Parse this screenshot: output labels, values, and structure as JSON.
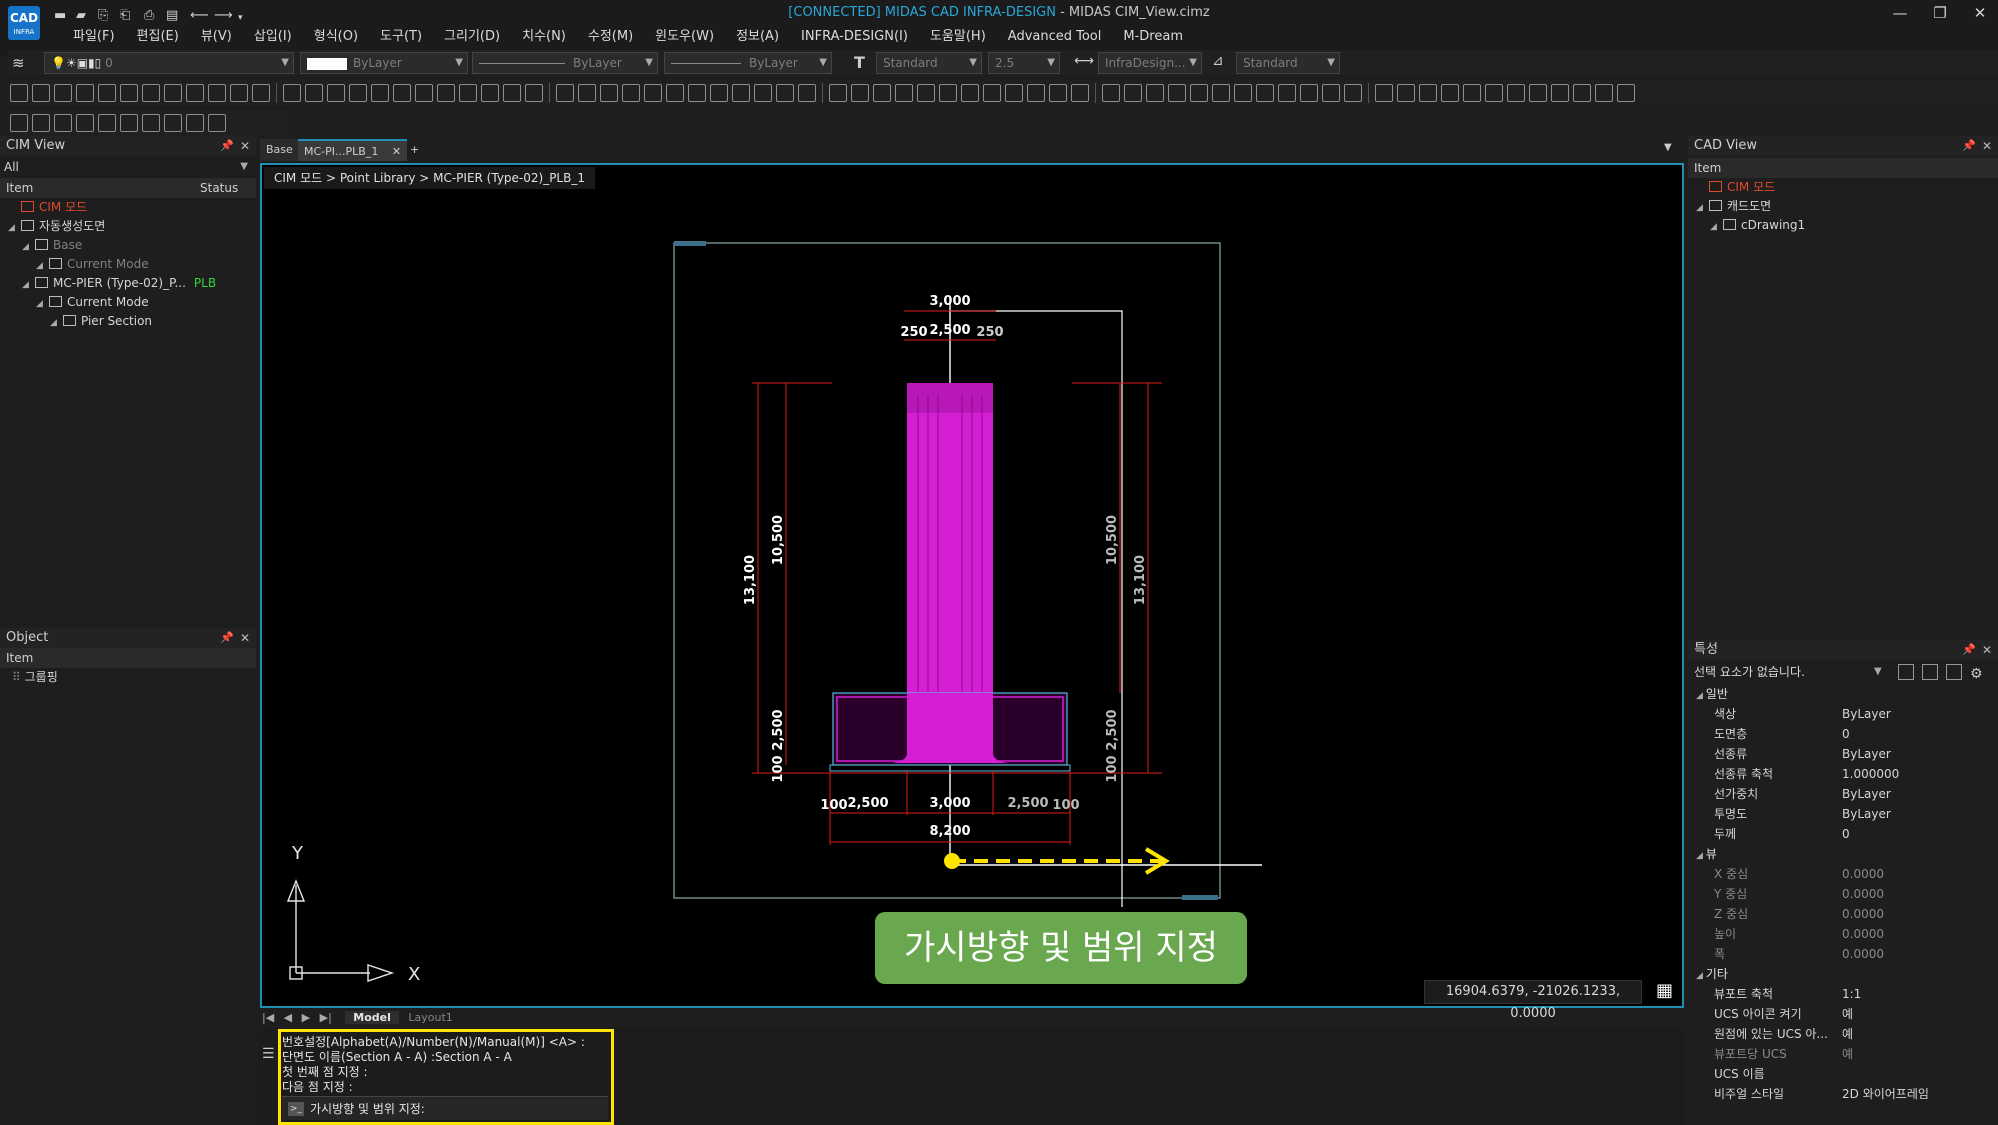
{
  "app": {
    "title_connected": "[CONNECTED] MIDAS CAD INFRA-DESIGN",
    "title_file": " - MIDAS CIM_View.cimz",
    "logo_text": "CAD"
  },
  "menu": [
    "파일(F)",
    "편집(E)",
    "뷰(V)",
    "삽입(I)",
    "형식(O)",
    "도구(T)",
    "그리기(D)",
    "치수(N)",
    "수정(M)",
    "윈도우(W)",
    "정보(A)",
    "INFRA-DESIGN(I)",
    "도움말(H)",
    "Advanced Tool",
    "M-Dream"
  ],
  "toolbar": {
    "layer_value": "0",
    "color_value": "ByLayer",
    "linetype_value": "ByLayer",
    "lineweight_value": "ByLayer",
    "textstyle_value": "Standard",
    "textheight_value": "2.5",
    "dimstyle_value": "InfraDesign...",
    "tablestyle_value": "Standard"
  },
  "cim_view": {
    "title": "CIM View",
    "filter": "All",
    "col_item": "Item",
    "col_status": "Status",
    "tree": [
      {
        "label": "CIM 모드",
        "level": 0,
        "style": "red"
      },
      {
        "label": "자동생성도면",
        "level": 0,
        "style": "normal"
      },
      {
        "label": "Base",
        "level": 1,
        "style": "dim"
      },
      {
        "label": "Current Mode",
        "level": 2,
        "style": "dim"
      },
      {
        "label": "MC-PIER (Type-02)_P...",
        "level": 1,
        "style": "normal",
        "status": "PLB"
      },
      {
        "label": "Current Mode",
        "level": 2,
        "style": "normal"
      },
      {
        "label": "Pier Section",
        "level": 3,
        "style": "normal"
      }
    ]
  },
  "object_panel": {
    "title": "Object",
    "col_item": "Item",
    "items": [
      "그룹핑"
    ]
  },
  "doc_tabs": [
    "Base",
    "MC-PI...PLB_1"
  ],
  "breadcrumb": "CIM 모드 > Point Library > MC-PIER (Type-02)_PLB_1",
  "drawing": {
    "dims_top": [
      "3,000",
      "250",
      "2,500",
      "250"
    ],
    "dims_left": [
      "13,100",
      "10,500",
      "2,500",
      "100"
    ],
    "dims_right": [
      "10,500",
      "13,100",
      "2,500",
      "100"
    ],
    "dims_bottom": [
      "100",
      "2,500",
      "3,000",
      "2,500",
      "100"
    ],
    "dim_total": "8,200",
    "axis_x": "X",
    "axis_y": "Y"
  },
  "callout": "가시방향 및 범위 지정",
  "coords": "16904.6379, -21026.1233, 0.0000",
  "layout_tabs": [
    "Model",
    "Layout1"
  ],
  "command": {
    "lines": [
      "번호설정[Alphabet(A)/Number(N)/Manual(M)] <A> :",
      "단면도 이름(Section A - A) :Section A - A",
      "첫 번째 점 지정 :",
      "다음 점 지정 :"
    ],
    "prompt": "가시방향 및 범위 지정:"
  },
  "cad_view": {
    "title": "CAD View",
    "col_item": "Item",
    "tree": [
      {
        "label": "CIM 모드",
        "level": 0,
        "style": "red"
      },
      {
        "label": "캐드도면",
        "level": 0,
        "style": "normal"
      },
      {
        "label": "cDrawing1",
        "level": 1,
        "style": "normal"
      }
    ]
  },
  "properties": {
    "title": "특성",
    "selection": "선택 요소가 없습니다.",
    "categories": [
      {
        "name": "일반",
        "rows": [
          {
            "k": "색상",
            "v": "ByLayer"
          },
          {
            "k": "도면층",
            "v": "0"
          },
          {
            "k": "선종류",
            "v": "ByLayer"
          },
          {
            "k": "선종류 축척",
            "v": "1.000000"
          },
          {
            "k": "선가중치",
            "v": "ByLayer"
          },
          {
            "k": "투명도",
            "v": "ByLayer"
          },
          {
            "k": "두께",
            "v": "0"
          }
        ]
      },
      {
        "name": "뷰",
        "rows": [
          {
            "k": "X 중심",
            "v": "0.0000",
            "dim": true
          },
          {
            "k": "Y 중심",
            "v": "0.0000",
            "dim": true
          },
          {
            "k": "Z 중심",
            "v": "0.0000",
            "dim": true
          },
          {
            "k": "높이",
            "v": "0.0000",
            "dim": true
          },
          {
            "k": "폭",
            "v": "0.0000",
            "dim": true
          }
        ]
      },
      {
        "name": "기타",
        "rows": [
          {
            "k": "뷰포트 축척",
            "v": "1:1"
          },
          {
            "k": "UCS 아이콘 켜기",
            "v": "예"
          },
          {
            "k": "원점에 있는 UCS 아...",
            "v": "예"
          },
          {
            "k": "뷰포트당 UCS",
            "v": "예",
            "dim": true
          },
          {
            "k": "UCS 이름",
            "v": ""
          },
          {
            "k": "비주얼 스타일",
            "v": "2D 와이어프레임"
          }
        ]
      }
    ]
  },
  "colors": {
    "accent": "#1f8fb5",
    "pier_fill": "#d41fd4",
    "dim_line": "#e01b1b",
    "arrow": "#ffe400",
    "callout": "#6aa84f"
  }
}
